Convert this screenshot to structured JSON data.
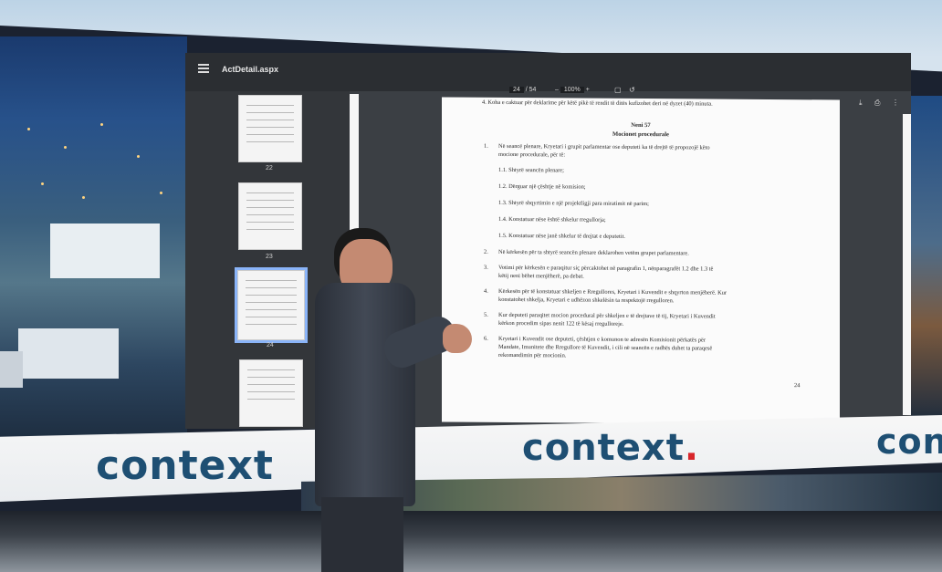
{
  "viewer": {
    "doc_title": "ActDetail.aspx",
    "page_current": "24",
    "page_total": "/ 54",
    "zoom": "100%",
    "zoom_minus": "–",
    "zoom_plus": "+",
    "thumbnails": [
      {
        "label": "22"
      },
      {
        "label": "23"
      },
      {
        "label": "24",
        "selected": true
      },
      {
        "label": ""
      }
    ]
  },
  "document": {
    "top_line": "4.   Koha e caktuar për deklarime për këtë pikë të rendit të ditës kufizohet deri në dyzet (40) minuta.",
    "heading_1": "Neni 57",
    "heading_2": "Mocionet procedurale",
    "items": [
      {
        "num": "1.",
        "text": "Në seancë plenare, Kryetari i grupit parlamentar ose deputeti ka të drejtë të propozojë këto"
      },
      {
        "num": "",
        "text": "mocione procedurale, për të:"
      },
      {
        "num": "",
        "text": "1.1.  Shtyrë seancën plenare;"
      },
      {
        "num": "",
        "text": "1.2.  Dërguar një çështje në komision;"
      },
      {
        "num": "",
        "text": "1.3.  Shtyrë shqyrtimin e një projektligji para miratimit në parim;"
      },
      {
        "num": "",
        "text": "1.4.  Konstatuar nëse është shkelur rregullorja;"
      },
      {
        "num": "",
        "text": "1.5.  Konstatuar nëse janë shkelur të drejtat e deputetit."
      },
      {
        "num": "2.",
        "text": "Në kërkesën për ta shtyrë seancën plenare deklarohen vetëm grupet parlamentare."
      },
      {
        "num": "3.",
        "text": "Votimi për kërkesën e paraqitur siç përcaktohet në paragrafin 1, nënparagrafët 1.2 dhe 1.3 të"
      },
      {
        "num": "",
        "text": "këtij neni bëhet menjëherë, pa debat."
      },
      {
        "num": "4.",
        "text": "Kërkesën për të konstatuar shkeljen e Rregullores, Kryetari i Kuvendit e shqyrton menjëherë. Kur"
      },
      {
        "num": "",
        "text": "konstatohet shkelja, Kryetari e udhëzon shkelësin ta respektojë rregulloren."
      },
      {
        "num": "5.",
        "text": "Kur deputeti paraqitet mocion procedural për shkeljen e të drejtave të tij, Kryetari i Kuvendit"
      },
      {
        "num": "",
        "text": "kërkon procedim sipas nenit 122 të kësaj rregulloreje."
      },
      {
        "num": "6.",
        "text": "Kryetari i Kuvendit ose deputeti, çështjen e komunon te adresën Komisionit përkatës për"
      },
      {
        "num": "",
        "text": "Mandate, Imunitete dhe Rregullore të Kuvendit, i cili në seancën e radhës duhet ta paraqesë"
      },
      {
        "num": "",
        "text": "rekomandimin për mocionin."
      }
    ],
    "page_number": "24"
  },
  "branding": {
    "logo_text": "context",
    "logo_dot": ".",
    "logo_partial_right": "con",
    "accent_color": "#d8262b",
    "logo_color": "#1e4f73"
  }
}
